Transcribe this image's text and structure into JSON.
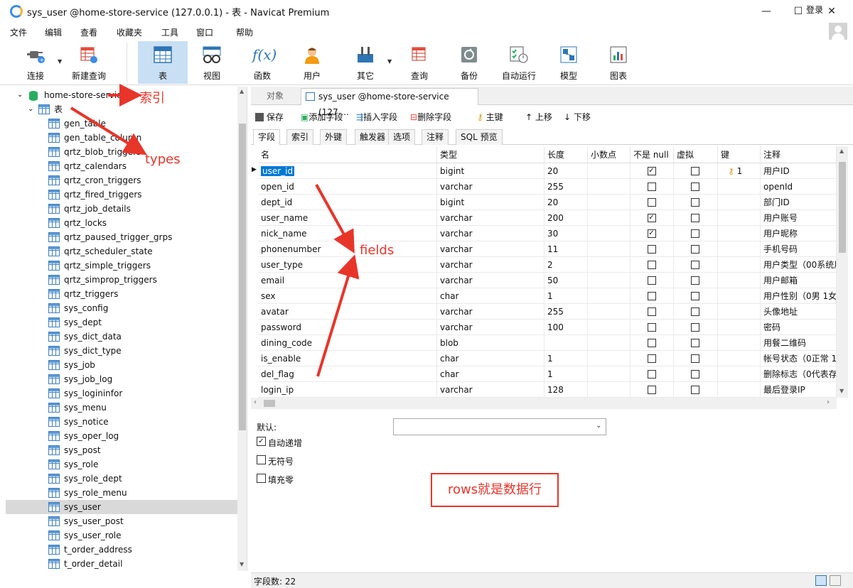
{
  "window": {
    "title": "sys_user @home-store-service (127.0.0.1) - 表 - Navicat Premium",
    "controls": [
      "—",
      "☐",
      "✕"
    ]
  },
  "menu": [
    "文件",
    "编辑",
    "查看",
    "收藏夹",
    "工具",
    "窗口",
    "帮助"
  ],
  "login_label": "登录",
  "toolbar": [
    {
      "label": "连接",
      "icon": "plug-icon"
    },
    {
      "label": "新建查询",
      "icon": "new-query-icon"
    },
    {
      "label": "表",
      "icon": "table-icon"
    },
    {
      "label": "视图",
      "icon": "view-icon"
    },
    {
      "label": "函数",
      "icon": "function-icon",
      "glyph": "f(x)"
    },
    {
      "label": "用户",
      "icon": "user-icon"
    },
    {
      "label": "其它",
      "icon": "tools-icon"
    },
    {
      "label": "查询",
      "icon": "query-icon"
    },
    {
      "label": "备份",
      "icon": "backup-icon"
    },
    {
      "label": "自动运行",
      "icon": "schedule-icon"
    },
    {
      "label": "模型",
      "icon": "model-icon"
    },
    {
      "label": "图表",
      "icon": "chart-icon"
    }
  ],
  "tree": {
    "connection": "home-store-service",
    "group": "表",
    "tables": [
      "gen_table",
      "gen_table_column",
      "qrtz_blob_triggers",
      "qrtz_calendars",
      "qrtz_cron_triggers",
      "qrtz_fired_triggers",
      "qrtz_job_details",
      "qrtz_locks",
      "qrtz_paused_trigger_grps",
      "qrtz_scheduler_state",
      "qrtz_simple_triggers",
      "qrtz_simprop_triggers",
      "qrtz_triggers",
      "sys_config",
      "sys_dept",
      "sys_dict_data",
      "sys_dict_type",
      "sys_job",
      "sys_job_log",
      "sys_logininfor",
      "sys_menu",
      "sys_notice",
      "sys_oper_log",
      "sys_post",
      "sys_role",
      "sys_role_dept",
      "sys_role_menu",
      "sys_user",
      "sys_user_post",
      "sys_user_role",
      "t_order_address",
      "t_order_detail"
    ],
    "selected": "sys_user"
  },
  "tabs": {
    "objects": "对象",
    "active": "sys_user @home-store-service (127...."
  },
  "designer_toolbar": [
    "保存",
    "添加字段",
    "插入字段",
    "删除字段",
    "主键",
    "上移",
    "下移"
  ],
  "subtabs": [
    "字段",
    "索引",
    "外键",
    "触发器",
    "选项",
    "注释",
    "SQL 预览"
  ],
  "grid": {
    "headers": [
      "名",
      "类型",
      "长度",
      "小数点",
      "不是 null",
      "虚拟",
      "键",
      "注释"
    ],
    "rows": [
      {
        "name": "user_id",
        "type": "bigint",
        "length": "20",
        "decimal": "",
        "not_null": true,
        "virtual": false,
        "key": "1",
        "comment": "用户ID"
      },
      {
        "name": "open_id",
        "type": "varchar",
        "length": "255",
        "decimal": "",
        "not_null": false,
        "virtual": false,
        "key": "",
        "comment": "openId"
      },
      {
        "name": "dept_id",
        "type": "bigint",
        "length": "20",
        "decimal": "",
        "not_null": false,
        "virtual": false,
        "key": "",
        "comment": "部门ID"
      },
      {
        "name": "user_name",
        "type": "varchar",
        "length": "200",
        "decimal": "",
        "not_null": true,
        "virtual": false,
        "key": "",
        "comment": "用户账号"
      },
      {
        "name": "nick_name",
        "type": "varchar",
        "length": "30",
        "decimal": "",
        "not_null": true,
        "virtual": false,
        "key": "",
        "comment": "用户昵称"
      },
      {
        "name": "phonenumber",
        "type": "varchar",
        "length": "11",
        "decimal": "",
        "not_null": false,
        "virtual": false,
        "key": "",
        "comment": "手机号码"
      },
      {
        "name": "user_type",
        "type": "varchar",
        "length": "2",
        "decimal": "",
        "not_null": false,
        "virtual": false,
        "key": "",
        "comment": "用户类型（00系统用"
      },
      {
        "name": "email",
        "type": "varchar",
        "length": "50",
        "decimal": "",
        "not_null": false,
        "virtual": false,
        "key": "",
        "comment": "用户邮箱"
      },
      {
        "name": "sex",
        "type": "char",
        "length": "1",
        "decimal": "",
        "not_null": false,
        "virtual": false,
        "key": "",
        "comment": "用户性别（0男 1女"
      },
      {
        "name": "avatar",
        "type": "varchar",
        "length": "255",
        "decimal": "",
        "not_null": false,
        "virtual": false,
        "key": "",
        "comment": "头像地址"
      },
      {
        "name": "password",
        "type": "varchar",
        "length": "100",
        "decimal": "",
        "not_null": false,
        "virtual": false,
        "key": "",
        "comment": "密码"
      },
      {
        "name": "dining_code",
        "type": "blob",
        "length": "",
        "decimal": "",
        "not_null": false,
        "virtual": false,
        "key": "",
        "comment": "用餐二维码"
      },
      {
        "name": "is_enable",
        "type": "char",
        "length": "1",
        "decimal": "",
        "not_null": false,
        "virtual": false,
        "key": "",
        "comment": "帐号状态（0正常 1"
      },
      {
        "name": "del_flag",
        "type": "char",
        "length": "1",
        "decimal": "",
        "not_null": false,
        "virtual": false,
        "key": "",
        "comment": "删除标志（0代表存"
      },
      {
        "name": "login_ip",
        "type": "varchar",
        "length": "128",
        "decimal": "",
        "not_null": false,
        "virtual": false,
        "key": "",
        "comment": "最后登录IP"
      }
    ]
  },
  "options": {
    "default_label": "默认:",
    "auto_increment": {
      "label": "自动递增",
      "checked": true
    },
    "unsigned": {
      "label": "无符号",
      "checked": false
    },
    "zerofill": {
      "label": "填充零",
      "checked": false
    }
  },
  "status": {
    "field_count": "字段数: 22"
  },
  "annotations": {
    "index": "索引",
    "types": "types",
    "fields": "fields",
    "rows_note": "rows就是数据行"
  },
  "colors": {
    "accent": "#c9dff3",
    "selection": "#0078d7",
    "annotation": "#e8352a"
  }
}
